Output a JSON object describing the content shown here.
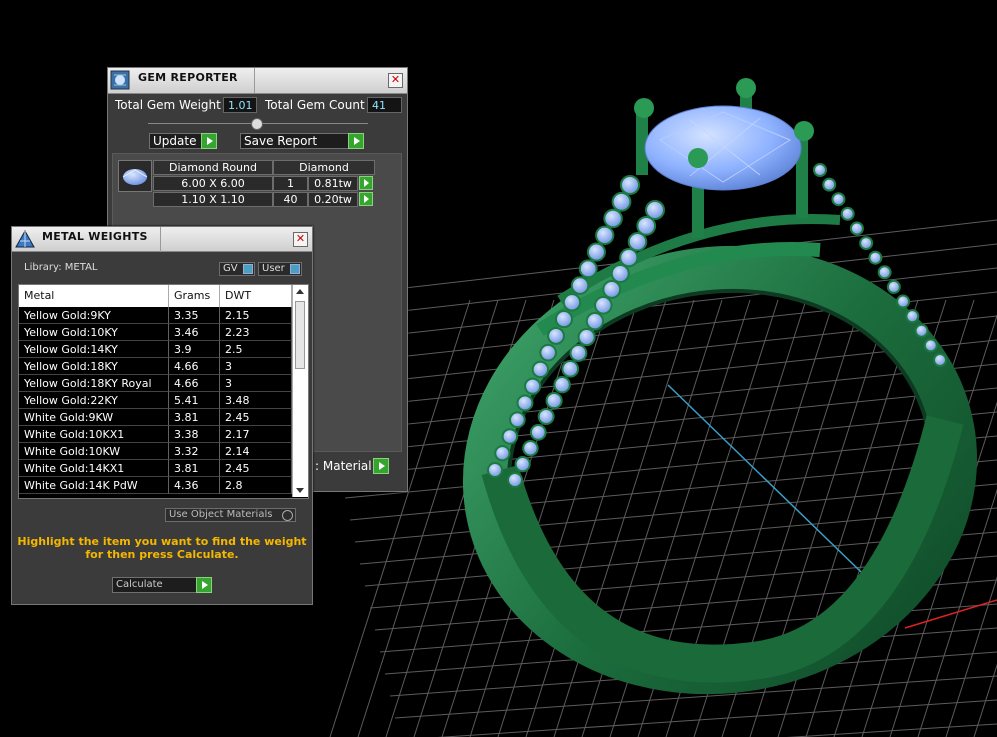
{
  "gem_reporter": {
    "title": "GEM REPORTER",
    "total_gem_weight_label": "Total Gem Weight",
    "total_gem_weight_value": "1.01",
    "total_gem_count_label": "Total Gem Count",
    "total_gem_count_value": "41",
    "update_label": "Update",
    "save_report_label": "Save Report",
    "gem_type_header": "Diamond Round",
    "material_header": "Diamond",
    "rows": [
      {
        "size": "6.00 X 6.00",
        "count": "1",
        "weight": "0.81tw"
      },
      {
        "size": "1.10 X 1.10",
        "count": "40",
        "weight": "0.20tw"
      }
    ],
    "material_button_label": ": Material"
  },
  "metal_weights": {
    "title": "METAL WEIGHTS",
    "library_label": "Library: METAL",
    "gv_label": "GV",
    "user_label": "User",
    "columns": [
      "Metal",
      "Grams",
      "DWT"
    ],
    "rows": [
      {
        "metal": "Yellow Gold:9KY",
        "grams": "3.35",
        "dwt": "2.15"
      },
      {
        "metal": "Yellow Gold:10KY",
        "grams": "3.46",
        "dwt": "2.23"
      },
      {
        "metal": "Yellow Gold:14KY",
        "grams": "3.9",
        "dwt": "2.5"
      },
      {
        "metal": "Yellow Gold:18KY",
        "grams": "4.66",
        "dwt": "3"
      },
      {
        "metal": "Yellow Gold:18KY Royal",
        "grams": "4.66",
        "dwt": "3"
      },
      {
        "metal": "Yellow Gold:22KY",
        "grams": "5.41",
        "dwt": "3.48"
      },
      {
        "metal": "White Gold:9KW",
        "grams": "3.81",
        "dwt": "2.45"
      },
      {
        "metal": "White Gold:10KX1",
        "grams": "3.38",
        "dwt": "2.17"
      },
      {
        "metal": "White Gold:10KW",
        "grams": "3.32",
        "dwt": "2.14"
      },
      {
        "metal": "White Gold:14KX1",
        "grams": "3.81",
        "dwt": "2.45"
      },
      {
        "metal": "White Gold:14K PdW",
        "grams": "4.36",
        "dwt": "2.8"
      }
    ],
    "use_object_materials_label": "Use Object Materials",
    "instruction_line1": "Highlight the item you want to find the weight",
    "instruction_line2": "for then press Calculate.",
    "calculate_label": "Calculate"
  },
  "colors": {
    "viewport_background": "#000000",
    "grid": "#5c5c5c",
    "ring_metal": "#1f7a45",
    "gem": "#8fb4ff",
    "accent_green": "#35a52f",
    "instruction_text": "#f5b800",
    "value_text": "#8ee3ff"
  }
}
